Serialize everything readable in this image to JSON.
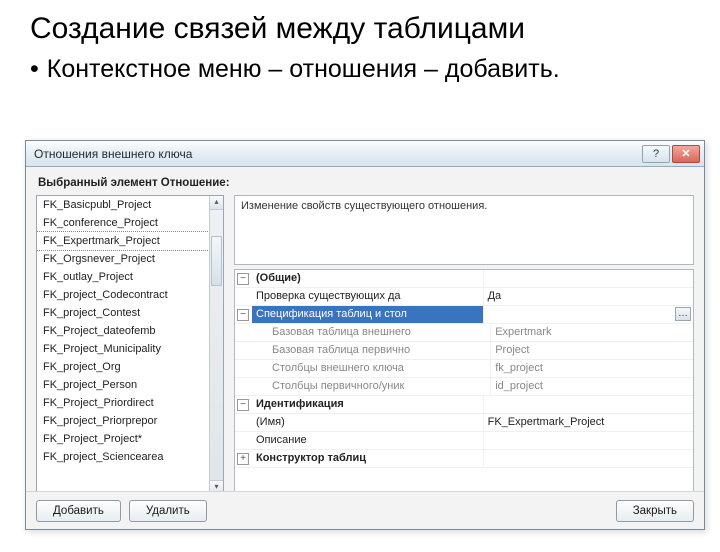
{
  "slide": {
    "title": "Создание связей между таблицами",
    "bullet": "Контекстное меню – отношения – добавить."
  },
  "dialog": {
    "title": "Отношения внешнего ключа",
    "leftLabel": "Выбранный элемент Отношение:",
    "list": [
      "FK_Basicpubl_Project",
      "FK_conference_Project",
      "FK_Expertmark_Project",
      "FK_Orgsnever_Project",
      "FK_outlay_Project",
      "FK_project_Codecontract",
      "FK_project_Contest",
      "FK_Project_dateofemb",
      "FK_Project_Municipality",
      "FK_project_Org",
      "FK_project_Person",
      "FK_Project_Priordirect",
      "FK_project_Priorprepor",
      "FK_Project_Project*",
      "FK_project_Sciencearea"
    ],
    "selectedIndex": 2,
    "description": "Изменение свойств существующего отношения.",
    "props": {
      "catGeneral": "(Общие)",
      "checkExisting": {
        "label": "Проверка существующих да",
        "value": "Да"
      },
      "specTables": "Спецификация таблиц и стол",
      "baseFkTable": {
        "label": "Базовая таблица внешнего",
        "value": "Expertmark"
      },
      "basePkTable": {
        "label": "Базовая таблица первично",
        "value": "Project"
      },
      "fkCols": {
        "label": "Столбцы внешнего ключа",
        "value": "fk_project"
      },
      "pkCols": {
        "label": "Столбцы первичного/уник",
        "value": "id_project"
      },
      "catIdent": "Идентификация",
      "name": {
        "label": "(Имя)",
        "value": "FK_Expertmark_Project"
      },
      "desc": {
        "label": "Описание",
        "value": ""
      },
      "catDesigner": "Конструктор таблиц"
    },
    "buttons": {
      "add": "Добавить",
      "delete": "Удалить",
      "close": "Закрыть"
    }
  }
}
